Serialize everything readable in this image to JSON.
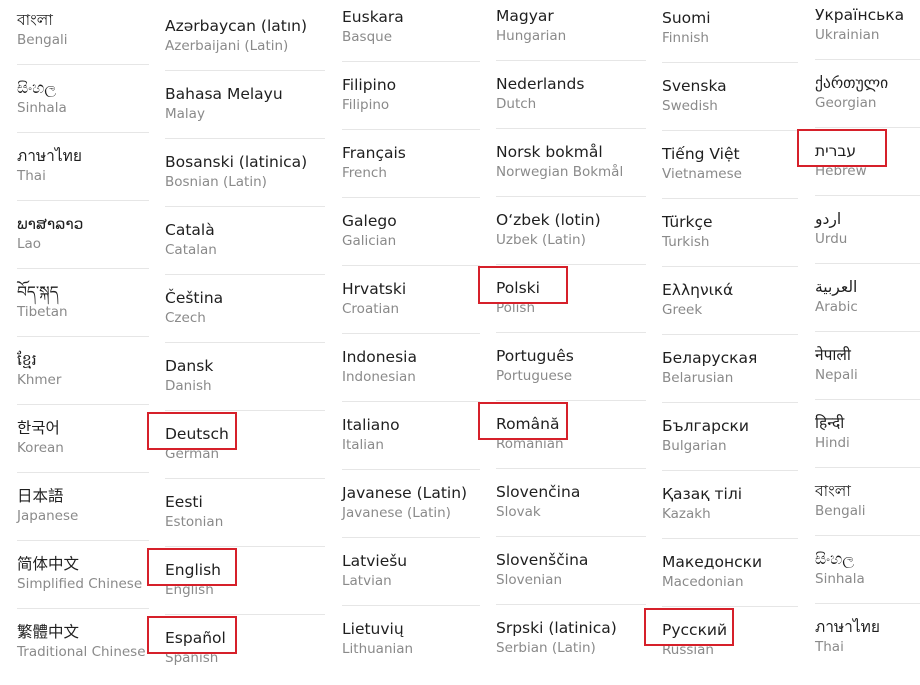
{
  "highlight_color": "#d6202a",
  "columns": [
    {
      "items": [
        {
          "name": "বাংলা",
          "sub": "Bengali"
        },
        {
          "name": "සිංහල",
          "sub": "Sinhala"
        },
        {
          "name": "ภาษาไทย",
          "sub": "Thai"
        },
        {
          "name": "ພາສາລາວ",
          "sub": "Lao"
        },
        {
          "name": "བོད་སྐད",
          "sub": "Tibetan"
        },
        {
          "name": "ខ្មែរ",
          "sub": "Khmer"
        },
        {
          "name": "한국어",
          "sub": "Korean"
        },
        {
          "name": "日本語",
          "sub": "Japanese"
        },
        {
          "name": "简体中文",
          "sub": "Simplified Chinese"
        },
        {
          "name": "繁體中文",
          "sub": "Traditional Chinese"
        }
      ]
    },
    {
      "items": [
        {
          "name": "Azərbaycan (latın)",
          "sub": "Azerbaijani (Latin)"
        },
        {
          "name": "Bahasa Melayu",
          "sub": "Malay"
        },
        {
          "name": "Bosanski (latinica)",
          "sub": "Bosnian (Latin)"
        },
        {
          "name": "Català",
          "sub": "Catalan"
        },
        {
          "name": "Čeština",
          "sub": "Czech"
        },
        {
          "name": "Dansk",
          "sub": "Danish"
        },
        {
          "name": "Deutsch",
          "sub": "German",
          "highlighted": true
        },
        {
          "name": "Eesti",
          "sub": "Estonian"
        },
        {
          "name": "English",
          "sub": "English",
          "highlighted": true
        },
        {
          "name": "Español",
          "sub": "Spanish",
          "highlighted": true
        }
      ]
    },
    {
      "items": [
        {
          "name": "Euskara",
          "sub": "Basque"
        },
        {
          "name": "Filipino",
          "sub": "Filipino"
        },
        {
          "name": "Français",
          "sub": "French"
        },
        {
          "name": "Galego",
          "sub": "Galician"
        },
        {
          "name": "Hrvatski",
          "sub": "Croatian"
        },
        {
          "name": "Indonesia",
          "sub": "Indonesian"
        },
        {
          "name": "Italiano",
          "sub": "Italian"
        },
        {
          "name": "Javanese (Latin)",
          "sub": "Javanese (Latin)"
        },
        {
          "name": "Latviešu",
          "sub": "Latvian"
        },
        {
          "name": "Lietuvių",
          "sub": "Lithuanian"
        }
      ]
    },
    {
      "items": [
        {
          "name": "Magyar",
          "sub": "Hungarian"
        },
        {
          "name": "Nederlands",
          "sub": "Dutch"
        },
        {
          "name": "Norsk bokmål",
          "sub": "Norwegian Bokmål"
        },
        {
          "name": "O‘zbek (lotin)",
          "sub": "Uzbek (Latin)"
        },
        {
          "name": "Polski",
          "sub": "Polish",
          "highlighted": true
        },
        {
          "name": "Português",
          "sub": "Portuguese"
        },
        {
          "name": "Română",
          "sub": "Romanian",
          "highlighted": true
        },
        {
          "name": "Slovenčina",
          "sub": "Slovak"
        },
        {
          "name": "Slovenščina",
          "sub": "Slovenian"
        },
        {
          "name": "Srpski (latinica)",
          "sub": "Serbian (Latin)"
        }
      ]
    },
    {
      "items": [
        {
          "name": "Suomi",
          "sub": "Finnish"
        },
        {
          "name": "Svenska",
          "sub": "Swedish"
        },
        {
          "name": "Tiếng Việt",
          "sub": "Vietnamese"
        },
        {
          "name": "Türkçe",
          "sub": "Turkish"
        },
        {
          "name": "Ελληνικά",
          "sub": "Greek"
        },
        {
          "name": "Беларуская",
          "sub": "Belarusian"
        },
        {
          "name": "Български",
          "sub": "Bulgarian"
        },
        {
          "name": "Қазақ тілі",
          "sub": "Kazakh"
        },
        {
          "name": "Македонски",
          "sub": "Macedonian"
        },
        {
          "name": "Русский",
          "sub": "Russian",
          "highlighted": true
        }
      ]
    },
    {
      "items": [
        {
          "name": "Українська",
          "sub": "Ukrainian"
        },
        {
          "name": "ქართული",
          "sub": "Georgian"
        },
        {
          "name": "עברית",
          "sub": "Hebrew",
          "highlighted": true
        },
        {
          "name": "اردو",
          "sub": "Urdu"
        },
        {
          "name": "العربية",
          "sub": "Arabic"
        },
        {
          "name": "नेपाली",
          "sub": "Nepali"
        },
        {
          "name": "हिन्दी",
          "sub": "Hindi"
        },
        {
          "name": "বাংলা",
          "sub": "Bengali"
        },
        {
          "name": "සිංහල",
          "sub": "Sinhala"
        },
        {
          "name": "ภาษาไทย",
          "sub": "Thai"
        }
      ]
    }
  ]
}
